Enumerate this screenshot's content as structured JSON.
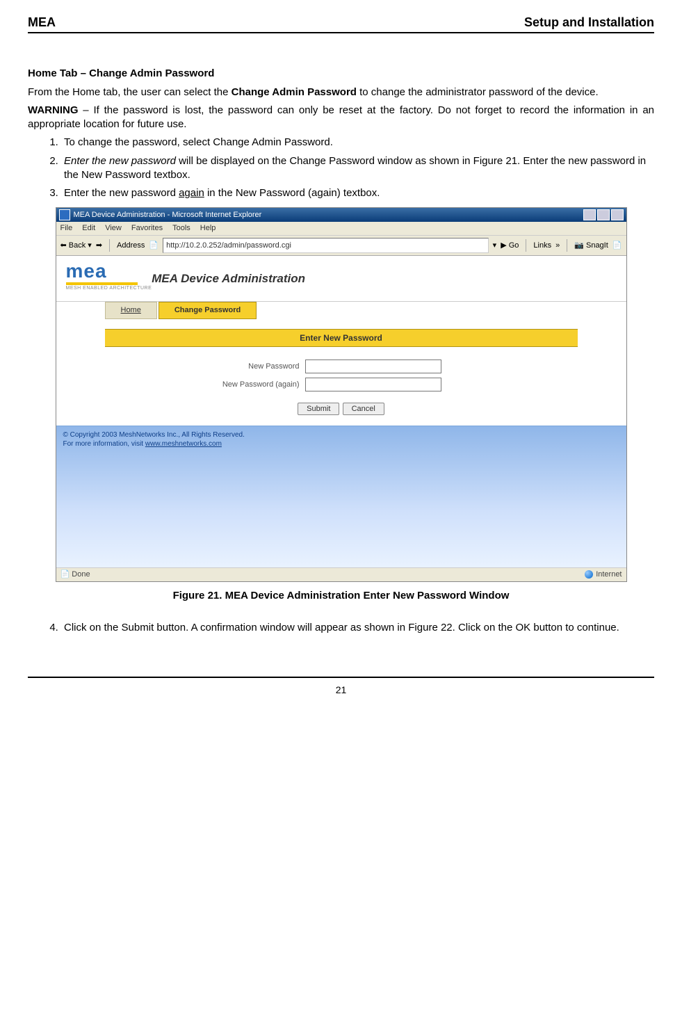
{
  "header": {
    "left": "MEA",
    "right": "Setup and Installation"
  },
  "section_title": "Home Tab – Change Admin Password",
  "intro_a": "From the Home tab, the user can select the ",
  "intro_bold": "Change Admin Password",
  "intro_b": " to change the administrator password of the device.",
  "warning_lead": "WARNING",
  "warning_text": " – If the password is lost, the password can only be reset at the factory.  Do not forget to record the information in an appropriate location for future use.",
  "steps": {
    "s1a": "To change the password, select ",
    "s1bold": "Change Admin Password",
    "s1b": ".",
    "s2italic": "Enter the new password",
    "s2a": " will be displayed on the Change Password window as shown in Figure 21.  Enter the new password in the ",
    "s2bold": "New Password",
    "s2b": " textbox.",
    "s3a": "Enter the new password ",
    "s3u": "again",
    "s3b": " in the ",
    "s3bold": "New Password (again)",
    "s3c": " textbox.",
    "s4a": "Click on the ",
    "s4bold1": "Submit",
    "s4b": " button.  A confirmation window will appear as shown in  Figure 22.  Click on the ",
    "s4bold2": "OK",
    "s4c": " button to continue."
  },
  "figcap": "Figure 21.      MEA Device Administration Enter New Password Window",
  "page_number": "21",
  "screenshot": {
    "title": "MEA Device Administration - Microsoft Internet Explorer",
    "menus": [
      "File",
      "Edit",
      "View",
      "Favorites",
      "Tools",
      "Help"
    ],
    "back": "Back",
    "addr_label": "Address",
    "addr_value": "http://10.2.0.252/admin/password.cgi",
    "go": "Go",
    "links": "Links",
    "snagit": "SnagIt",
    "logo_top": "mea",
    "logo_sub": "MESH ENABLED ARCHITECTURE",
    "admin_title": "MEA Device Administration",
    "tab_home": "Home",
    "tab_change": "Change Password",
    "enter_new": "Enter New Password",
    "lbl_pwd": "New Password",
    "lbl_pwd2": "New Password (again)",
    "btn_submit": "Submit",
    "btn_cancel": "Cancel",
    "copyright": "© Copyright 2003 MeshNetworks Inc., All Rights Reserved.",
    "moreinfo_a": "For more information, visit ",
    "moreinfo_link": "www.meshnetworks.com",
    "status_done": "Done",
    "status_net": "Internet"
  }
}
